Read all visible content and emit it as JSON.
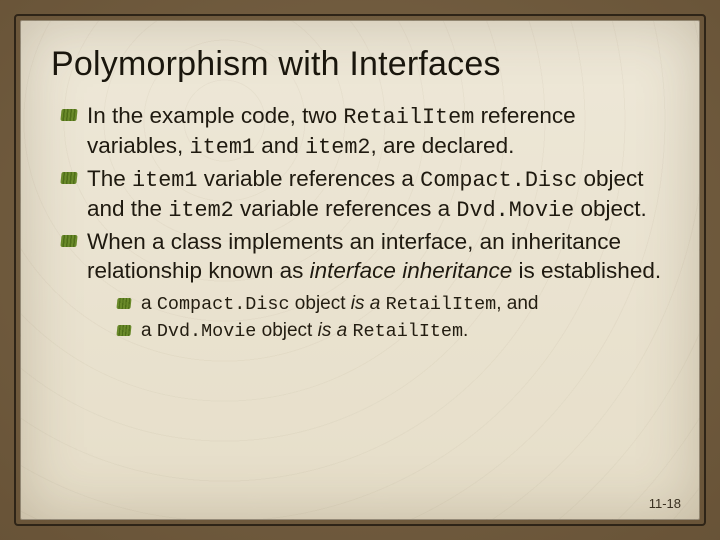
{
  "title": "Polymorphism with Interfaces",
  "b1": {
    "t1": "In the example code, two ",
    "c1": "RetailItem",
    "t2": " reference variables, ",
    "c2": "item1",
    "t3": " and ",
    "c3": "item2",
    "t4": ", are declared."
  },
  "b2": {
    "t1": "The ",
    "c1": "item1",
    "t2": " variable references a ",
    "c2": "Compact.Disc",
    "t3": " object and the ",
    "c3": "item2",
    "t4": " variable references a ",
    "c4": "Dvd.Movie",
    "t5": " object."
  },
  "b3": {
    "t1": "When a class implements an interface, an inheritance relationship known as ",
    "i1": "interface inheritance",
    "t2": " is established."
  },
  "s1": {
    "t1": "a ",
    "c1": "Compact.Disc",
    "t2": " object ",
    "i1": "is a",
    "t3": " ",
    "c2": "RetailItem",
    "t4": ", and"
  },
  "s2": {
    "t1": "a ",
    "c1": "Dvd.Movie",
    "t2": " object ",
    "i1": "is a",
    "t3": " ",
    "c2": "RetailItem",
    "t4": "."
  },
  "footer": "11-18"
}
